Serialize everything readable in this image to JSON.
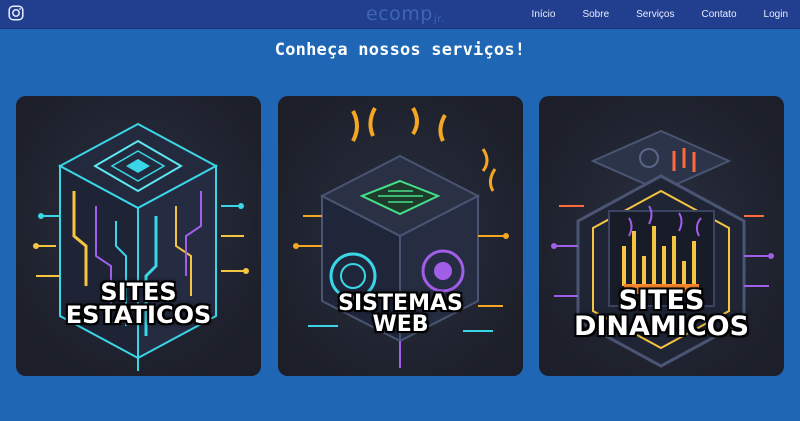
{
  "navbar": {
    "logo_text": "ecomp",
    "logo_suffix": "jr.",
    "links": [
      "Início",
      "Sobre",
      "Serviços",
      "Contato",
      "Login"
    ]
  },
  "heading": "Conheça nossos serviços!",
  "cards": [
    {
      "line1": "SITES",
      "line2": "ESTATICOS"
    },
    {
      "line1": "SISTEMAS",
      "line2": "WEB"
    },
    {
      "line1": "SITES",
      "line2": "DINAMICOS"
    }
  ],
  "colors": {
    "page_bg": "#1f67b5",
    "navbar_bg": "#223e8e",
    "card_bg": "#1f222c"
  }
}
